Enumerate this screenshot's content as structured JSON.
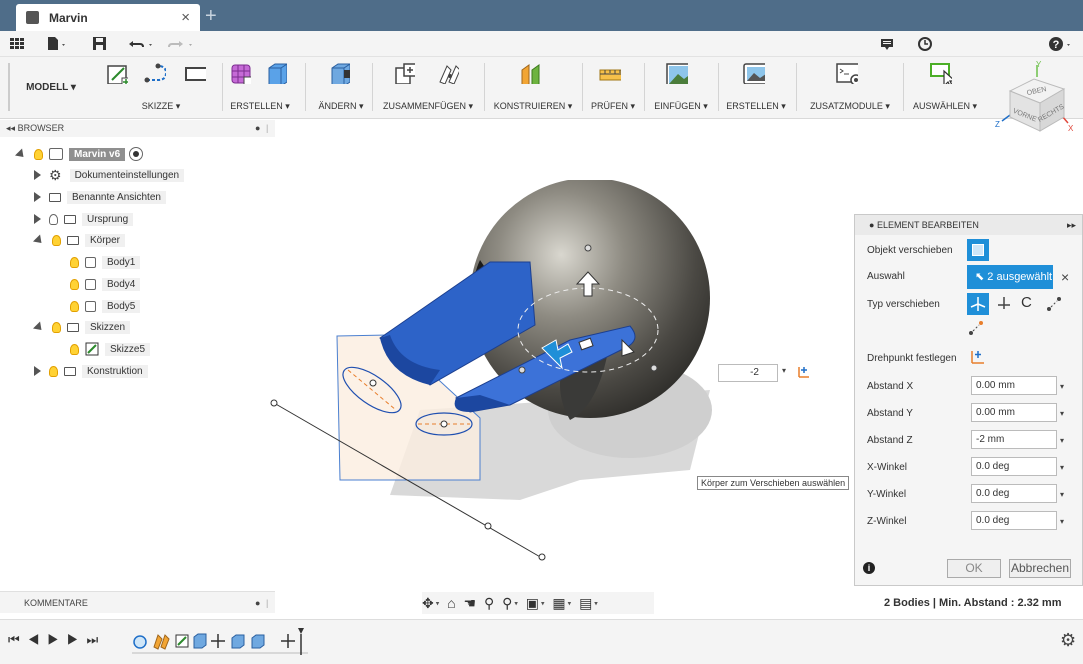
{
  "window": {
    "tab_title": "Marvin",
    "close": "×",
    "add": "+"
  },
  "toolbar": {
    "workspace": "MODELL ▾",
    "groups": [
      {
        "label": "SKIZZE ▾"
      },
      {
        "label": "ERSTELLEN ▾"
      },
      {
        "label": "ÄNDERN ▾"
      },
      {
        "label": "ZUSAMMENFÜGEN ▾"
      },
      {
        "label": "KONSTRUIEREN ▾"
      },
      {
        "label": "PRÜFEN ▾"
      },
      {
        "label": "EINFÜGEN ▾"
      },
      {
        "label": "ERSTELLEN ▾"
      },
      {
        "label": "ZUSATZMODULE ▾"
      },
      {
        "label": "AUSWÄHLEN ▾"
      }
    ]
  },
  "viewcube": {
    "top": "OBEN",
    "front": "VORNE",
    "right": "RECHTS",
    "axis_x": "X",
    "axis_y": "Y",
    "axis_z": "Z"
  },
  "browser": {
    "title": "BROWSER",
    "root": "Marvin v6",
    "items": [
      {
        "label": "Dokumenteinstellungen"
      },
      {
        "label": "Benannte Ansichten"
      },
      {
        "label": "Ursprung"
      },
      {
        "label": "Körper"
      },
      {
        "label": "Body1"
      },
      {
        "label": "Body4"
      },
      {
        "label": "Body5"
      },
      {
        "label": "Skizzen"
      },
      {
        "label": "Skizze5"
      },
      {
        "label": "Konstruktion"
      }
    ]
  },
  "panel": {
    "title": "ELEMENT BEARBEITEN",
    "rows": {
      "objekt": "Objekt verschieben",
      "auswahl": "Auswahl",
      "auswahl_value": "2 ausgewählt",
      "typ": "Typ verschieben",
      "drehpunkt": "Drehpunkt festlegen",
      "abstand_x": "Abstand X",
      "abstand_y": "Abstand Y",
      "abstand_z": "Abstand Z",
      "x_winkel": "X-Winkel",
      "y_winkel": "Y-Winkel",
      "z_winkel": "Z-Winkel"
    },
    "values": {
      "abstand_x": "0.00 mm",
      "abstand_y": "0.00 mm",
      "abstand_z": "-2 mm",
      "x_winkel": "0.0 deg",
      "y_winkel": "0.0 deg",
      "z_winkel": "0.0 deg"
    },
    "ok": "OK",
    "cancel": "Abbrechen"
  },
  "canvas": {
    "value_input": "-2",
    "tooltip": "Körper zum Verschieben auswählen"
  },
  "comments": {
    "title": "KOMMENTARE"
  },
  "status": {
    "text": "2 Bodies | Min. Abstand : 2.32 mm"
  },
  "colors": {
    "accent": "#1f8fd8",
    "titlebar": "#4f6d89",
    "body_blue": "#2d63c8",
    "sphere": "#6a6a66"
  }
}
